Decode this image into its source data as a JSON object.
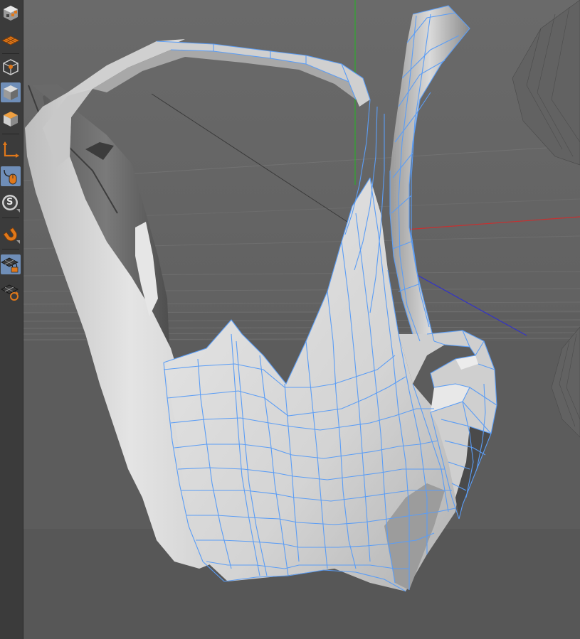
{
  "palette": {
    "tools": [
      {
        "name": "checkerboard-tool-icon",
        "active": false
      },
      {
        "name": "texture-grid-icon",
        "active": false
      },
      {
        "name": "points-mode-icon",
        "active": false
      },
      {
        "name": "model-mode-icon",
        "active": true
      },
      {
        "name": "object-mode-icon",
        "active": false
      },
      {
        "name": "axis-mode-icon",
        "active": false
      },
      {
        "name": "tweak-mode-icon",
        "active": true
      },
      {
        "name": "solo-s-icon",
        "active": false
      },
      {
        "name": "snap-magnet-icon",
        "active": false
      },
      {
        "name": "locked-workplane-icon",
        "active": true
      },
      {
        "name": "workplane-rotate-icon",
        "active": false
      }
    ],
    "solo_label": "S"
  },
  "viewport": {
    "background": "#616161",
    "floor_color": "#5b5b5b",
    "mesh_color": "#d6d6d6",
    "mesh_shadow": "#8c8c8c",
    "wire_color": "#5b9df5",
    "axis_x_color": "#c83030",
    "axis_y_color": "#2faa2f",
    "axis_z_color": "#3030c0"
  }
}
